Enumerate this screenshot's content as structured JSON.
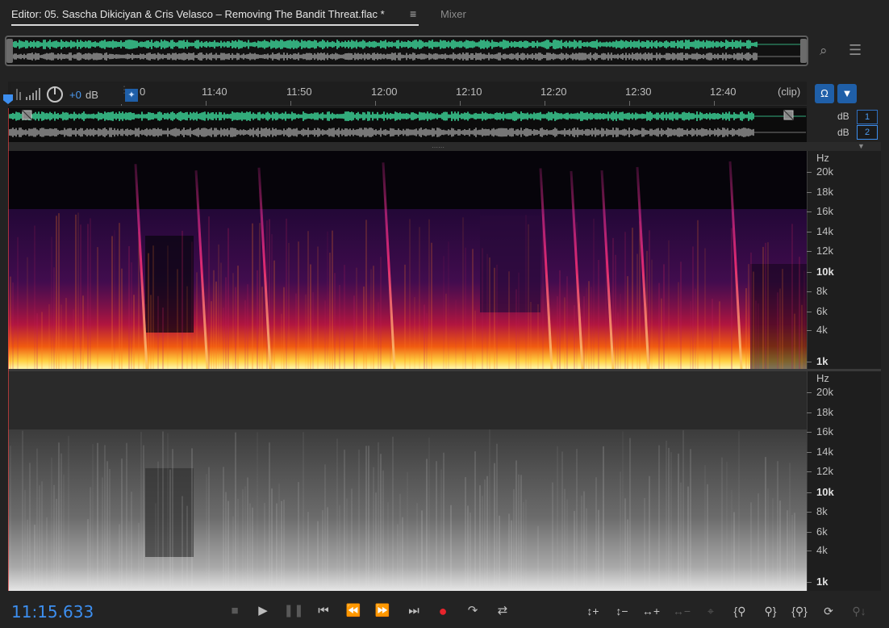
{
  "tabs": {
    "editor_label": "Editor: 05. Sascha Dikiciyan & Cris Velasco – Removing The Bandit Threat.flac *",
    "menu_icon": "hamburger-menu-icon",
    "mixer_label": "Mixer"
  },
  "hud": {
    "volume_value": "+0",
    "volume_unit": "dB"
  },
  "ruler": {
    "ticks": [
      "11:40",
      "11:50",
      "12:00",
      "12:10",
      "12:20",
      "12:30",
      "12:40"
    ],
    "partial_tick": "0",
    "clip_label": "(clip)"
  },
  "waveform": {
    "channel_1_db": "dB",
    "channel_2_db": "dB",
    "channel_1_button": "1",
    "channel_2_button": "2"
  },
  "spectral": {
    "unit": "Hz",
    "labels": [
      "20k",
      "18k",
      "16k",
      "14k",
      "12k",
      "10k",
      "8k",
      "6k",
      "4k",
      "1k"
    ]
  },
  "transport": {
    "timecode": "11:15.633",
    "buttons": [
      "stop",
      "play",
      "pause",
      "go-to-previous",
      "rewind",
      "fast-forward",
      "go-to-next",
      "record",
      "loop",
      "skip-selection"
    ]
  },
  "colors": {
    "accent": "#3d8ff0",
    "record": "#e8242c",
    "wave_active": "#3fe0a0",
    "wave_inactive": "#9a9a9a"
  }
}
